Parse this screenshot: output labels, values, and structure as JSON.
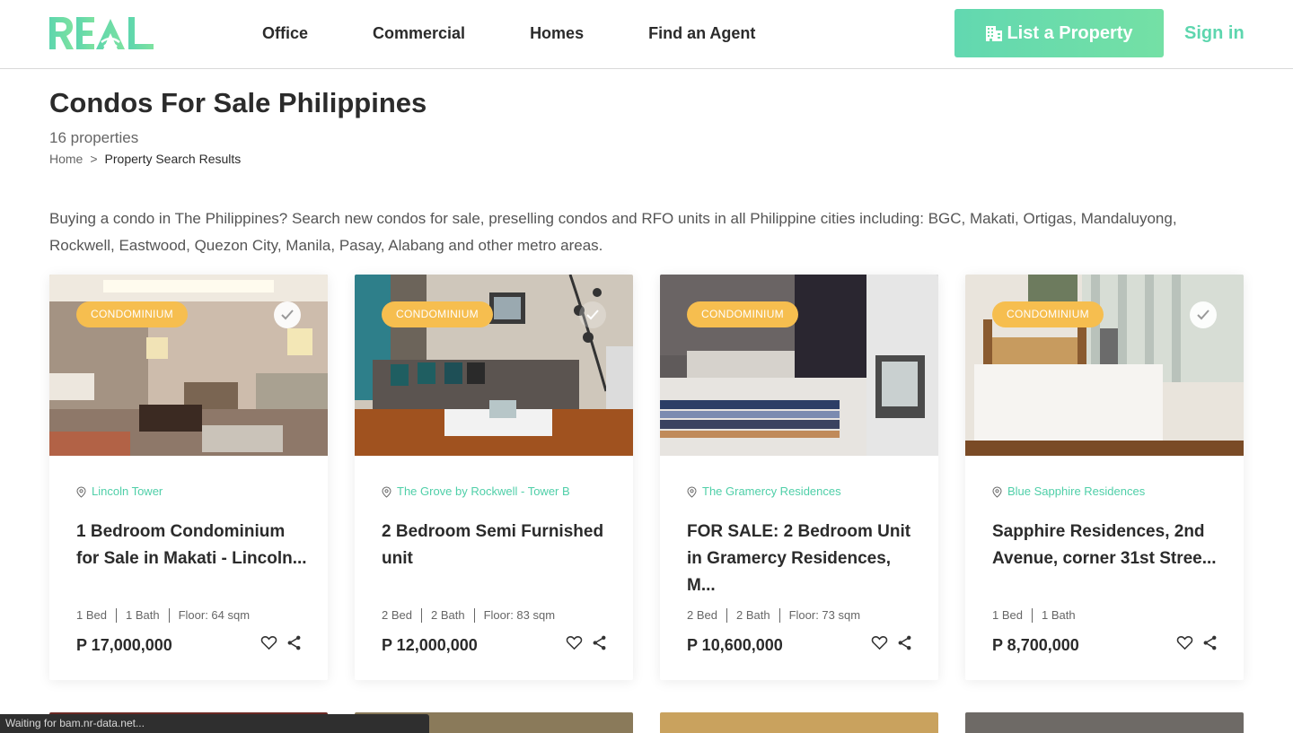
{
  "header": {
    "logo_text": "REAL",
    "nav": [
      "Office",
      "Commercial",
      "Homes",
      "Find an Agent"
    ],
    "list_button": "List a Property",
    "signin": "Sign in"
  },
  "page": {
    "title": "Condos For Sale Philippines",
    "count": "16 properties",
    "breadcrumb_home": "Home",
    "breadcrumb_sep": ">",
    "breadcrumb_current": "Property Search Results",
    "intro": "Buying a condo in The Philippines? Search new condos for sale, preselling condos and RFO units in all Philippine cities including: BGC, Makati, Ortigas, Mandaluyong, Rockwell, Eastwood, Quezon City, Manila, Pasay, Alabang and other metro areas."
  },
  "cards": [
    {
      "badge": "CONDOMINIUM",
      "location": "Lincoln Tower",
      "title": "1 Bedroom Condominium for Sale in Makati - Lincoln...",
      "bed": "1 Bed",
      "bath": "1 Bath",
      "floor": "Floor: 64 sqm",
      "price": "P 17,000,000"
    },
    {
      "badge": "CONDOMINIUM",
      "location": "The Grove by Rockwell - Tower B",
      "title": "2 Bedroom Semi Furnished unit",
      "bed": "2 Bed",
      "bath": "2 Bath",
      "floor": "Floor: 83 sqm",
      "price": "P 12,000,000"
    },
    {
      "badge": "CONDOMINIUM",
      "location": "The Gramercy Residences",
      "title": "FOR SALE: 2 Bedroom Unit in Gramercy Residences, M...",
      "bed": "2 Bed",
      "bath": "2 Bath",
      "floor": "Floor: 73 sqm",
      "price": "P 10,600,000"
    },
    {
      "badge": "CONDOMINIUM",
      "location": "Blue Sapphire Residences",
      "title": "Sapphire Residences, 2nd Avenue, corner 31st Stree...",
      "bed": "1 Bed",
      "bath": "1 Bath",
      "price": "P 8,700,000"
    }
  ],
  "status_bar": "Waiting for bam.nr-data.net...",
  "colors": {
    "accent": "#5dd6ae",
    "badge": "#f6be4f",
    "text": "#2b2b2b"
  },
  "icons": [
    "building-icon",
    "location-pin-icon",
    "check-icon",
    "heart-icon",
    "share-icon"
  ]
}
